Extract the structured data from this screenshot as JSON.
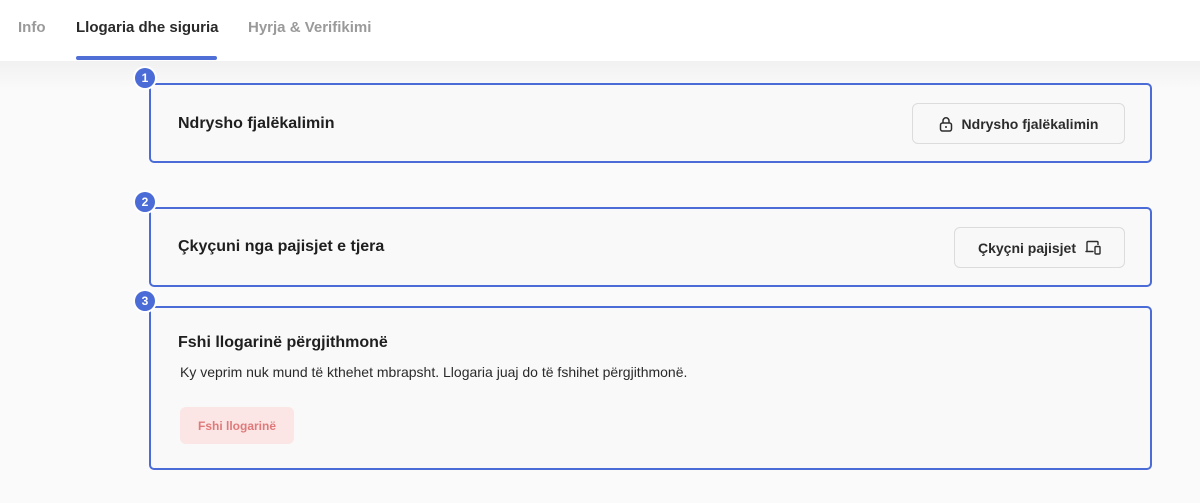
{
  "tabs": [
    {
      "label": "Info",
      "active": false
    },
    {
      "label": "Llogaria dhe siguria",
      "active": true
    },
    {
      "label": "Hyrja & Verifikimi",
      "active": false
    }
  ],
  "sections": {
    "change_password": {
      "badge": "1",
      "title": "Ndrysho fjalëkalimin",
      "button_label": "Ndrysho fjalëkalimin",
      "button_icon": "lock-icon"
    },
    "logout_devices": {
      "badge": "2",
      "title": "Çkyçuni nga pajisjet e tjera",
      "button_label": "Çkyçni pajisjet",
      "button_icon": "devices-icon"
    },
    "delete_account": {
      "badge": "3",
      "title": "Fshi llogarinë përgjithmonë",
      "description": "Ky veprim nuk mund të kthehet mbrapsht. Llogaria juaj do të fshihet përgjithmonë.",
      "button_label": "Fshi llogarinë"
    }
  },
  "colors": {
    "accent": "#4b6bd6",
    "danger_text": "#e07a7a",
    "danger_bg": "#fbe5e5"
  }
}
